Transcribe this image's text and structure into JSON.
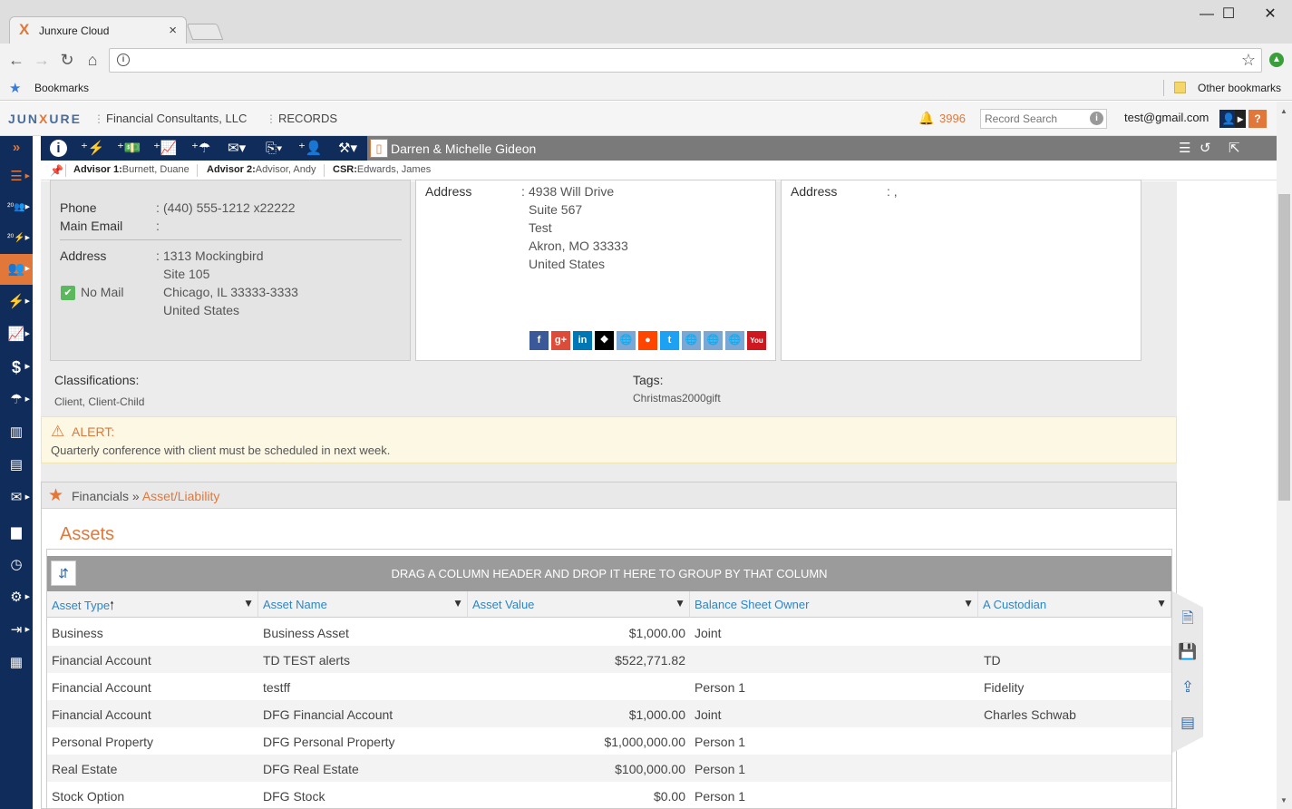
{
  "browser": {
    "tab_title": "Junxure Cloud",
    "tab_close": "×",
    "win_minimize": "—",
    "win_maximize": "☐",
    "win_close": "✕",
    "bookmarks_label": "Bookmarks",
    "other_bookmarks": "Other bookmarks"
  },
  "header": {
    "brand_prefix": "JUN",
    "brand_x": "X",
    "brand_suffix": "URE",
    "company": "Financial Consultants, LLC",
    "module": "RECORDS",
    "notification_count": "3996",
    "search_placeholder": "Record Search",
    "user_email": "test@gmail.com"
  },
  "record": {
    "name": "Darren & Michelle Gideon",
    "advisor1_label": "Advisor 1:",
    "advisor1": "Burnett, Duane",
    "advisor2_label": "Advisor 2:",
    "advisor2": "Advisor, Andy",
    "csr_label": "CSR:",
    "csr": "Edwards, James"
  },
  "contact": {
    "phone_label": "Phone",
    "phone": "(440) 555-1212 x22222",
    "email_label": "Main Email",
    "email": "",
    "colon": ":",
    "address_label": "Address",
    "address_lines": [
      "1313 Mockingbird",
      "Site 105",
      "Chicago, IL 33333-3333",
      "United States"
    ],
    "no_mail_label": "No Mail"
  },
  "business": {
    "address_label": "Address",
    "address_lines": [
      "4938 Will Drive",
      "Suite 567",
      "Test",
      "Akron, MO 33333",
      "United States"
    ]
  },
  "other": {
    "address_label": "Address",
    "address_value": ": ,"
  },
  "classifications": {
    "label": "Classifications:",
    "value": "Client, Client-Child"
  },
  "tags": {
    "label": "Tags:",
    "value": "Christmas2000gift"
  },
  "alert": {
    "title": "ALERT:",
    "message": "Quarterly conference with client must be scheduled in next week."
  },
  "financials": {
    "crumb_root": "Financials",
    "crumb_sep": "»",
    "crumb_active": "Asset/Liability",
    "section_title": "Assets",
    "group_hint": "DRAG A COLUMN HEADER AND DROP IT HERE TO GROUP BY THAT COLUMN",
    "columns": [
      "Asset Type",
      "Asset Name",
      "Asset Value",
      "Balance Sheet Owner",
      "A Custodian"
    ],
    "rows": [
      [
        "Business",
        "Business Asset",
        "$1,000.00",
        "Joint",
        ""
      ],
      [
        "Financial Account",
        "TD TEST alerts",
        "$522,771.82",
        "",
        "TD"
      ],
      [
        "Financial Account",
        "testff",
        "",
        "Person 1",
        "Fidelity"
      ],
      [
        "Financial Account",
        "DFG Financial Account",
        "$1,000.00",
        "Joint",
        "Charles Schwab"
      ],
      [
        "Personal Property",
        "DFG Personal Property",
        "$1,000,000.00",
        "Person 1",
        ""
      ],
      [
        "Real Estate",
        "DFG Real Estate",
        "$100,000.00",
        "Person 1",
        ""
      ],
      [
        "Stock Option",
        "DFG Stock",
        "$0.00",
        "Person 1",
        ""
      ]
    ]
  },
  "colors": {
    "accent": "#e1783a",
    "nav": "#0f2c5a",
    "link": "#2d85c6"
  }
}
